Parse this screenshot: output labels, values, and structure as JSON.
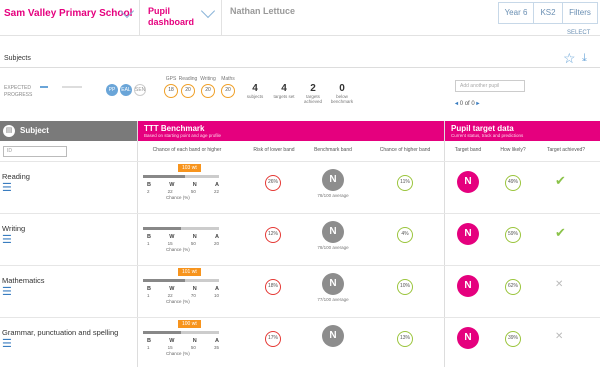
{
  "topbar": {
    "school": "Sam Valley Primary School",
    "pupil": "Pupil dashboard",
    "name": "Nathan Lettuce",
    "year": "Year 6",
    "ks": "KS2",
    "filters": "Filters",
    "select": "SELECT"
  },
  "tab": {
    "subjects": "Subjects"
  },
  "summary": {
    "legend": "EXPECTED PROGRESS",
    "pills": [
      "PP",
      "EAL",
      "SEN"
    ],
    "minis": [
      {
        "cap": "GPS",
        "val": "18"
      },
      {
        "cap": "Reading",
        "val": "20"
      },
      {
        "cap": "Writing",
        "val": "20"
      },
      {
        "cap": "Maths",
        "val": "20"
      }
    ],
    "stats": [
      {
        "num": "4",
        "cap": "subjects"
      },
      {
        "num": "4",
        "cap": "targets set"
      },
      {
        "num": "2",
        "cap": "targets achieved"
      },
      {
        "num": "0",
        "cap": "below benchmark"
      }
    ],
    "search": "Add another pupil",
    "pager_prefix": "◂",
    "pager_text": "0 of 0",
    "pager_suffix": "▸"
  },
  "headers": {
    "subject": "Subject",
    "ttt": "TTT Benchmark",
    "ttt_sub": "Based on starting point and age profile",
    "pt": "Pupil target data",
    "pt_sub": "Current status, track and predictions",
    "filter_placeholder": "ID",
    "col_chance": "Chance of each band or higher",
    "col_risk": "Risk of lower band",
    "col_bm": "Benchmark band",
    "col_higher": "Chance of higher band",
    "col_target": "Target band",
    "col_likely": "How likely?",
    "col_achieved": "Target achieved?"
  },
  "rows": [
    {
      "subject": "Reading",
      "badge": "103 wt",
      "fill": 0.55,
      "nums": [
        "2",
        "22",
        "50",
        "22"
      ],
      "chance_cap": "Chance (%)",
      "risk": "26%",
      "bm": "N",
      "bm_cap": "78/100 average",
      "higher": "11%",
      "target": "N",
      "likely": "49%",
      "achieved": "yes"
    },
    {
      "subject": "Writing",
      "badge": "",
      "fill": 0.5,
      "nums": [
        "1",
        "15",
        "50",
        "20"
      ],
      "chance_cap": "Chance (%)",
      "risk": "12%",
      "bm": "N",
      "bm_cap": "78/100 average",
      "higher": "4%",
      "target": "N",
      "likely": "59%",
      "achieved": "yes"
    },
    {
      "subject": "Mathematics",
      "badge": "101 wt",
      "fill": 0.55,
      "nums": [
        "1",
        "22",
        "70",
        "10"
      ],
      "chance_cap": "Chance (%)",
      "risk": "18%",
      "bm": "N",
      "bm_cap": "77/100 average",
      "higher": "10%",
      "target": "N",
      "likely": "62%",
      "achieved": "no"
    },
    {
      "subject": "Grammar, punctuation and spelling",
      "badge": "100 wt",
      "fill": 0.5,
      "nums": [
        "1",
        "15",
        "50",
        "35"
      ],
      "chance_cap": "Chance (%)",
      "risk": "17%",
      "bm": "N",
      "bm_cap": "",
      "higher": "13%",
      "target": "N",
      "likely": "39%",
      "achieved": "no"
    }
  ],
  "colors": {
    "accent": "#e5007e",
    "blue": "#6aa5d8",
    "green": "#8bc34a",
    "red": "#e53935",
    "orange": "#f7941d"
  }
}
